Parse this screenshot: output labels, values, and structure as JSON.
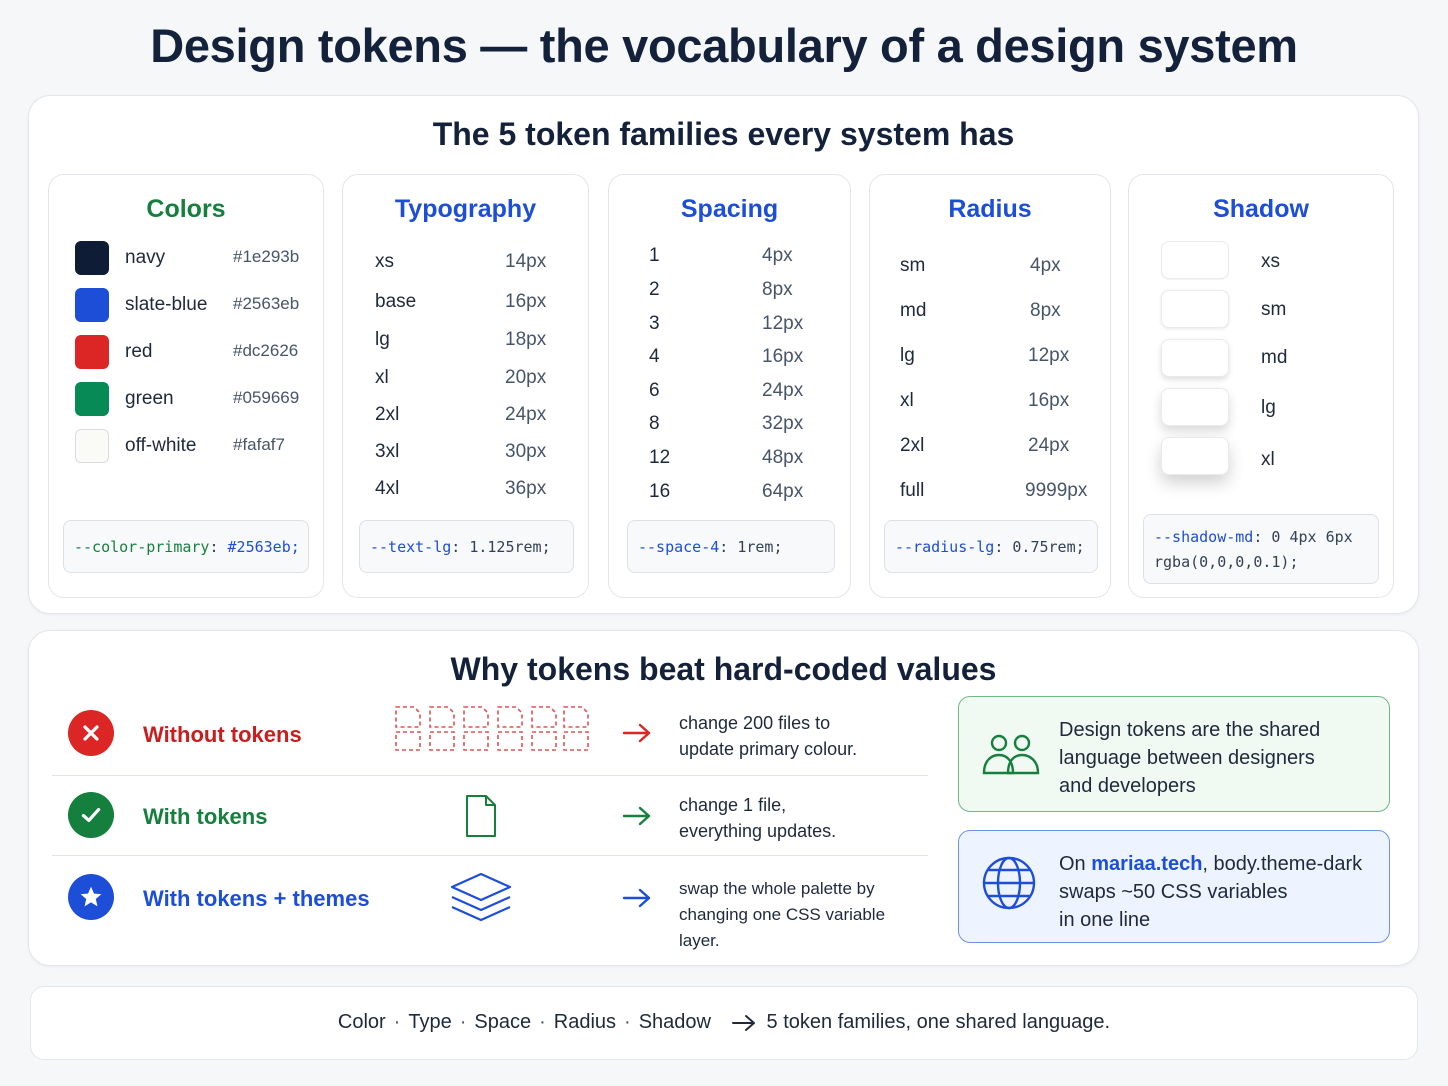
{
  "title": "Design tokens — the vocabulary of a design system",
  "families": {
    "title": "The 5 token families every system has",
    "colors": {
      "title": "Colors",
      "items": [
        {
          "name": "navy",
          "hex": "#1e293b"
        },
        {
          "name": "slate-blue",
          "hex": "#2563eb"
        },
        {
          "name": "red",
          "hex": "#dc2626"
        },
        {
          "name": "green",
          "hex": "#059669"
        },
        {
          "name": "off-white",
          "hex": "#fafaf7"
        }
      ],
      "code_name": "--color-primary",
      "code_value": "#2563eb;"
    },
    "typography": {
      "title": "Typography",
      "items": [
        {
          "k": "xs",
          "v": "14px"
        },
        {
          "k": "base",
          "v": "16px"
        },
        {
          "k": "lg",
          "v": "18px"
        },
        {
          "k": "xl",
          "v": "20px"
        },
        {
          "k": "2xl",
          "v": "24px"
        },
        {
          "k": "3xl",
          "v": "30px"
        },
        {
          "k": "4xl",
          "v": "36px"
        }
      ],
      "code_name": "--text-lg",
      "code_value": "1.125rem;"
    },
    "spacing": {
      "title": "Spacing",
      "items": [
        {
          "k": "1",
          "v": "4px"
        },
        {
          "k": "2",
          "v": "8px"
        },
        {
          "k": "3",
          "v": "12px"
        },
        {
          "k": "4",
          "v": "16px"
        },
        {
          "k": "6",
          "v": "24px"
        },
        {
          "k": "8",
          "v": "32px"
        },
        {
          "k": "12",
          "v": "48px"
        },
        {
          "k": "16",
          "v": "64px"
        }
      ],
      "code_name": "--space-4",
      "code_value": "1rem;"
    },
    "radius": {
      "title": "Radius",
      "items": [
        {
          "k": "sm",
          "v": "4px"
        },
        {
          "k": "md",
          "v": "8px"
        },
        {
          "k": "lg",
          "v": "12px"
        },
        {
          "k": "xl",
          "v": "16px"
        },
        {
          "k": "2xl",
          "v": "24px"
        },
        {
          "k": "full",
          "v": "9999px"
        }
      ],
      "code_name": "--radius-lg",
      "code_value": "0.75rem;"
    },
    "shadow": {
      "title": "Shadow",
      "items": [
        "xs",
        "sm",
        "md",
        "lg",
        "xl"
      ],
      "code_name": "--shadow-md",
      "code_value": "0 4px 6px",
      "code_line2": "rgba(0,0,0,0.1);"
    }
  },
  "why": {
    "title": "Why tokens beat hard-coded values",
    "rows": [
      {
        "label": "Without tokens",
        "desc1": "change 200 files to",
        "desc2": "update primary colour."
      },
      {
        "label": "With tokens",
        "desc1": "change 1 file,",
        "desc2": "everything updates."
      },
      {
        "label": "With tokens + themes",
        "desc1": "swap the whole palette by",
        "desc2": "changing one CSS variable layer."
      }
    ],
    "info_green": {
      "line1": "Design tokens are the shared",
      "line2": "language between designers",
      "line3": "and developers"
    },
    "info_blue": {
      "pre": "On ",
      "link": "mariaa.tech",
      "post": ", body.theme-dark",
      "line2": "swaps ~50 CSS variables",
      "line3": "in one line"
    }
  },
  "footer": {
    "items": [
      "Color",
      "Type",
      "Space",
      "Radius",
      "Shadow"
    ],
    "tail": "5 token families, one shared language."
  },
  "accents": {
    "green": "#15803d",
    "blue": "#1d4ed8",
    "red": "#dc2626"
  }
}
